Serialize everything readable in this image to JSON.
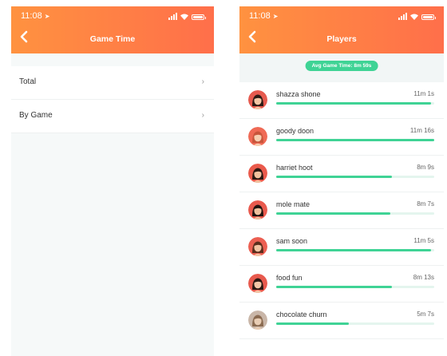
{
  "left_screen": {
    "status": {
      "time": "11:08"
    },
    "header": {
      "title": "Game Time"
    },
    "menu": [
      {
        "label": "Total"
      },
      {
        "label": "By Game"
      }
    ]
  },
  "right_screen": {
    "status": {
      "time": "11:08"
    },
    "header": {
      "title": "Players"
    },
    "avg_label": "Avg Game Time: 8m 59s",
    "players": [
      {
        "name": "shazza shone",
        "time": "11m 1s",
        "progress": 0.98
      },
      {
        "name": "goody doon",
        "time": "11m 16s",
        "progress": 1.0
      },
      {
        "name": "harriet hoot",
        "time": "8m 9s",
        "progress": 0.73
      },
      {
        "name": "mole mate",
        "time": "8m 7s",
        "progress": 0.72
      },
      {
        "name": "sam soon",
        "time": "11m 5s",
        "progress": 0.98
      },
      {
        "name": "food fun",
        "time": "8m 13s",
        "progress": 0.73
      },
      {
        "name": "chocolate churn",
        "time": "5m 7s",
        "progress": 0.46
      }
    ]
  },
  "colors": {
    "header_gradient_start": "#ff9240",
    "header_gradient_end": "#ff6f4a",
    "progress": "#3fd395",
    "track": "#e4f5ee"
  },
  "icons": {
    "location": "location-arrow-icon",
    "back": "chevron-left-icon",
    "menu_chevron": "chevron-right-icon"
  }
}
